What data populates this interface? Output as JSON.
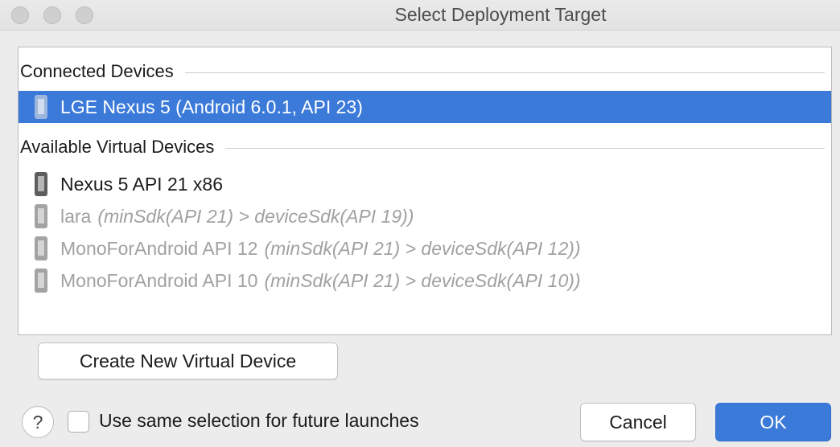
{
  "window": {
    "title": "Select Deployment Target"
  },
  "device_list": {
    "connected_header": "Connected Devices",
    "connected": [
      {
        "name": "LGE Nexus 5 (Android 6.0.1, API 23)",
        "note": "",
        "selected": true,
        "icon": "phone-icon"
      }
    ],
    "virtual_header": "Available Virtual Devices",
    "virtual": [
      {
        "name": "Nexus 5 API 21 x86",
        "note": "",
        "disabled": false,
        "icon": "phone-icon"
      },
      {
        "name": "lara",
        "note": "(minSdk(API 21) > deviceSdk(API 19))",
        "disabled": true,
        "icon": "phone-icon"
      },
      {
        "name": "MonoForAndroid API 12",
        "note": "(minSdk(API 21) > deviceSdk(API 12))",
        "disabled": true,
        "icon": "phone-icon"
      },
      {
        "name": "MonoForAndroid API 10",
        "note": "(minSdk(API 21) > deviceSdk(API 10))",
        "disabled": true,
        "icon": "phone-icon"
      }
    ]
  },
  "buttons": {
    "create_label": "Create New Virtual Device",
    "cancel_label": "Cancel",
    "ok_label": "OK",
    "help_label": "?"
  },
  "footer": {
    "checkbox_label": "Use same selection for future launches",
    "checkbox_checked": false
  },
  "colors": {
    "selection": "#3b7ad9",
    "disabled_text": "#a1a1a1"
  }
}
